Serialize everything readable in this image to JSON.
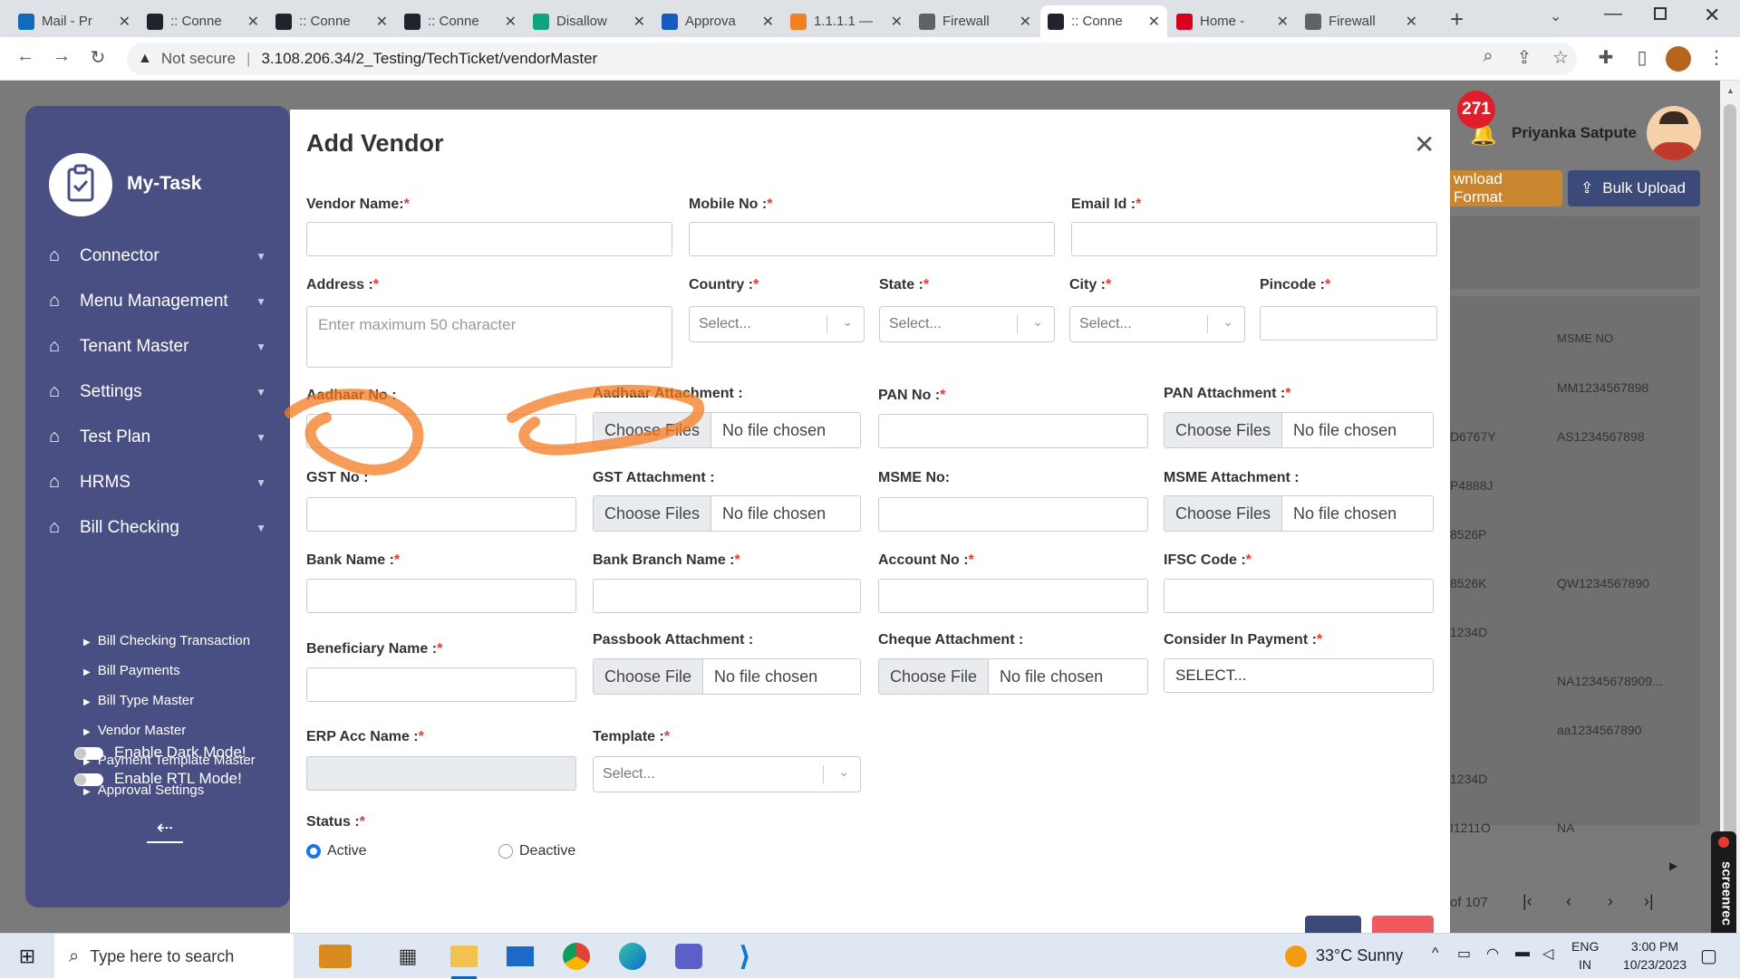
{
  "browser": {
    "tabs": [
      {
        "label": "Mail - Pr",
        "icon": "outlook-icon",
        "color": "#0f6cbd"
      },
      {
        "label": ":: Conne",
        "icon": "react-icon",
        "color": "#20232a"
      },
      {
        "label": ":: Conne",
        "icon": "react-icon",
        "color": "#20232a"
      },
      {
        "label": ":: Conne",
        "icon": "react-icon",
        "color": "#20232a"
      },
      {
        "label": "Disallow",
        "icon": "chatgpt-icon",
        "color": "#10a37f"
      },
      {
        "label": "Approva",
        "icon": "word-icon",
        "color": "#185abd"
      },
      {
        "label": "1.1.1.1 —",
        "icon": "cloudflare-icon",
        "color": "#f38020"
      },
      {
        "label": "Firewall",
        "icon": "globe-icon",
        "color": "#5f6368"
      },
      {
        "label": ":: Conne",
        "icon": "react-icon",
        "color": "#20232a",
        "active": true
      },
      {
        "label": "Home -",
        "icon": "wifi-icon",
        "color": "#d9001b"
      },
      {
        "label": "Firewall",
        "icon": "globe-icon",
        "color": "#5f6368"
      }
    ],
    "security": "Not secure",
    "url": "3.108.206.34/2_Testing/TechTicket/vendorMaster"
  },
  "sidebar": {
    "brand": "My-Task",
    "items": [
      {
        "label": "Connector"
      },
      {
        "label": "Menu Management"
      },
      {
        "label": "Tenant Master"
      },
      {
        "label": "Settings"
      },
      {
        "label": "Test Plan"
      },
      {
        "label": "HRMS"
      },
      {
        "label": "Bill Checking"
      }
    ],
    "subitems": [
      {
        "label": "Bill Checking Transaction"
      },
      {
        "label": "Bill Payments"
      },
      {
        "label": "Bill Type Master"
      },
      {
        "label": "Vendor Master"
      },
      {
        "label": "Payment Template Master"
      },
      {
        "label": "Approval Settings"
      }
    ],
    "dark_mode": "Enable Dark Mode!",
    "rtl_mode": "Enable RTL Mode!"
  },
  "header": {
    "notifications": "271",
    "user": "Priyanka Satpute",
    "download_format": "wnload Format",
    "bulk_upload": "Bulk Upload"
  },
  "bg_table": {
    "column": "MSME NO",
    "col1": [
      "",
      "D6767Y",
      "P4888J",
      "8526P",
      "8526K",
      "1234D",
      "",
      "",
      "1234D",
      "I1211O"
    ],
    "col2": [
      "MM1234567898",
      "AS1234567898",
      "",
      "",
      "QW1234567890",
      "",
      "NA12345678909...",
      "aa1234567890",
      "",
      "NA"
    ],
    "pager": "of 107"
  },
  "modal": {
    "title": "Add Vendor",
    "fields": {
      "vendor_name": "Vendor Name:",
      "mobile_no": "Mobile No :",
      "email_id": "Email Id :",
      "address": "Address :",
      "address_ph": "Enter maximum 50 character",
      "country": "Country :",
      "state": "State :",
      "city": "City :",
      "pincode": "Pincode :",
      "select_ph": "Select...",
      "aadhaar_no": "Aadhaar No :",
      "aadhaar_att": "Aadhaar Attachment :",
      "pan_no": "PAN No :",
      "pan_att": "PAN Attachment :",
      "gst_no": "GST No :",
      "gst_att": "GST Attachment :",
      "msme_no": "MSME No:",
      "msme_att": "MSME Attachment :",
      "bank_name": "Bank Name :",
      "bank_branch": "Bank Branch Name :",
      "account_no": "Account No :",
      "ifsc": "IFSC Code :",
      "beneficiary": "Beneficiary Name :",
      "passbook_att": "Passbook Attachment :",
      "cheque_att": "Cheque Attachment :",
      "consider_payment": "Consider In Payment :",
      "consider_value": "SELECT...",
      "erp_acc": "ERP Acc Name :",
      "template": "Template :",
      "status": "Status :",
      "active": "Active",
      "deactive": "Deactive"
    },
    "req": "*",
    "choose_files": "Choose Files",
    "choose_file": "Choose File",
    "no_file": "No file chosen"
  },
  "taskbar": {
    "search": "Type here to search",
    "weather": "33°C  Sunny",
    "lang1": "ENG",
    "lang2": "IN",
    "time": "3:00 PM",
    "date": "10/23/2023",
    "screenrec": "screenrec"
  }
}
